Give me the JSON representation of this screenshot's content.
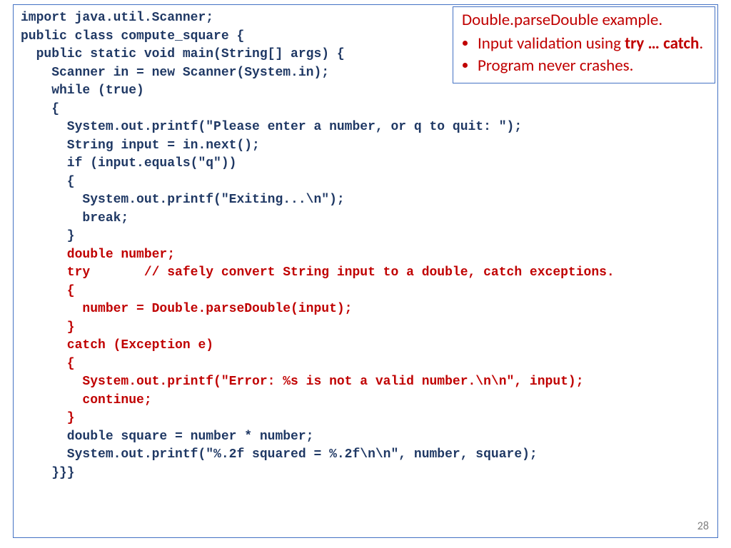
{
  "callout": {
    "title": "Double.parseDouble example.",
    "bullets": [
      {
        "pre": "Input validation using ",
        "bold": "try … catch",
        "post": "."
      },
      {
        "pre": "Program never crashes.",
        "bold": "",
        "post": ""
      }
    ]
  },
  "code": {
    "l01": "import java.util.Scanner;",
    "l02": "public class compute_square {",
    "l03": "  public static void main(String[] args) {",
    "l04": "    Scanner in = new Scanner(System.in);",
    "l05": "    while (true)",
    "l06": "    {",
    "l07": "      System.out.printf(\"Please enter a number, or q to quit: \");",
    "l08": "      String input = in.next();",
    "l09": "      if (input.equals(\"q\"))",
    "l10": "      {",
    "l11": "        System.out.printf(\"Exiting...\\n\");",
    "l12": "        break;",
    "l13": "      }",
    "l14": "      double number;",
    "l15a": "      try       ",
    "l15b": "// safely convert String input to a double, catch exceptions.",
    "l16": "      {",
    "l17": "        number = Double.parseDouble(input);",
    "l18": "      }",
    "l19": "      catch (Exception e)",
    "l20": "      {",
    "l21": "        System.out.printf(\"Error: %s is not a valid number.\\n\\n\", input);",
    "l22": "        continue;",
    "l23": "      }",
    "l24": "      double square = number * number;",
    "l25": "      System.out.printf(\"%.2f squared = %.2f\\n\\n\", number, square);",
    "l26": "    }}}"
  },
  "page_number": "28"
}
